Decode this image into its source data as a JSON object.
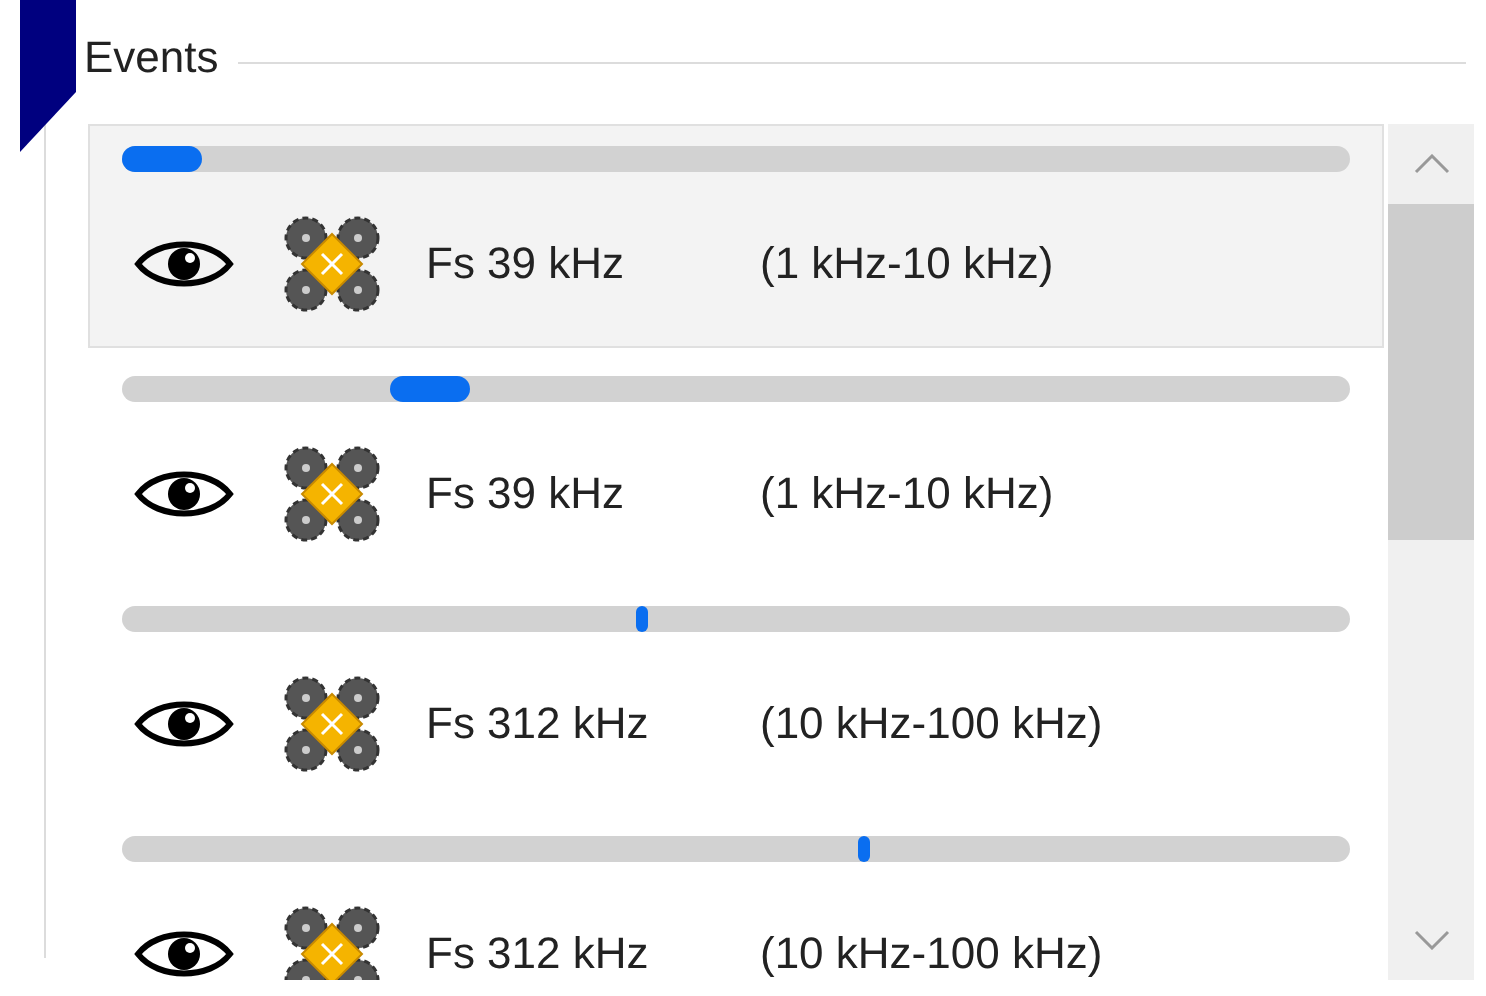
{
  "group": {
    "title": "Events"
  },
  "events": [
    {
      "selected": true,
      "kind": "wide",
      "rate": "Fs 39 kHz",
      "band": "(1 kHz-10 kHz)",
      "level": 0.033
    },
    {
      "selected": false,
      "kind": "wide",
      "rate": "Fs 39 kHz",
      "band": "(1 kHz-10 kHz)",
      "level": 0.25
    },
    {
      "selected": false,
      "kind": "narrow",
      "rate": "Fs 312 kHz",
      "band": "(10 kHz-100 kHz)",
      "level": 0.424
    },
    {
      "selected": false,
      "kind": "narrow",
      "rate": "Fs 312 kHz",
      "band": "(10 kHz-100 kHz)",
      "level": 0.604
    }
  ]
}
